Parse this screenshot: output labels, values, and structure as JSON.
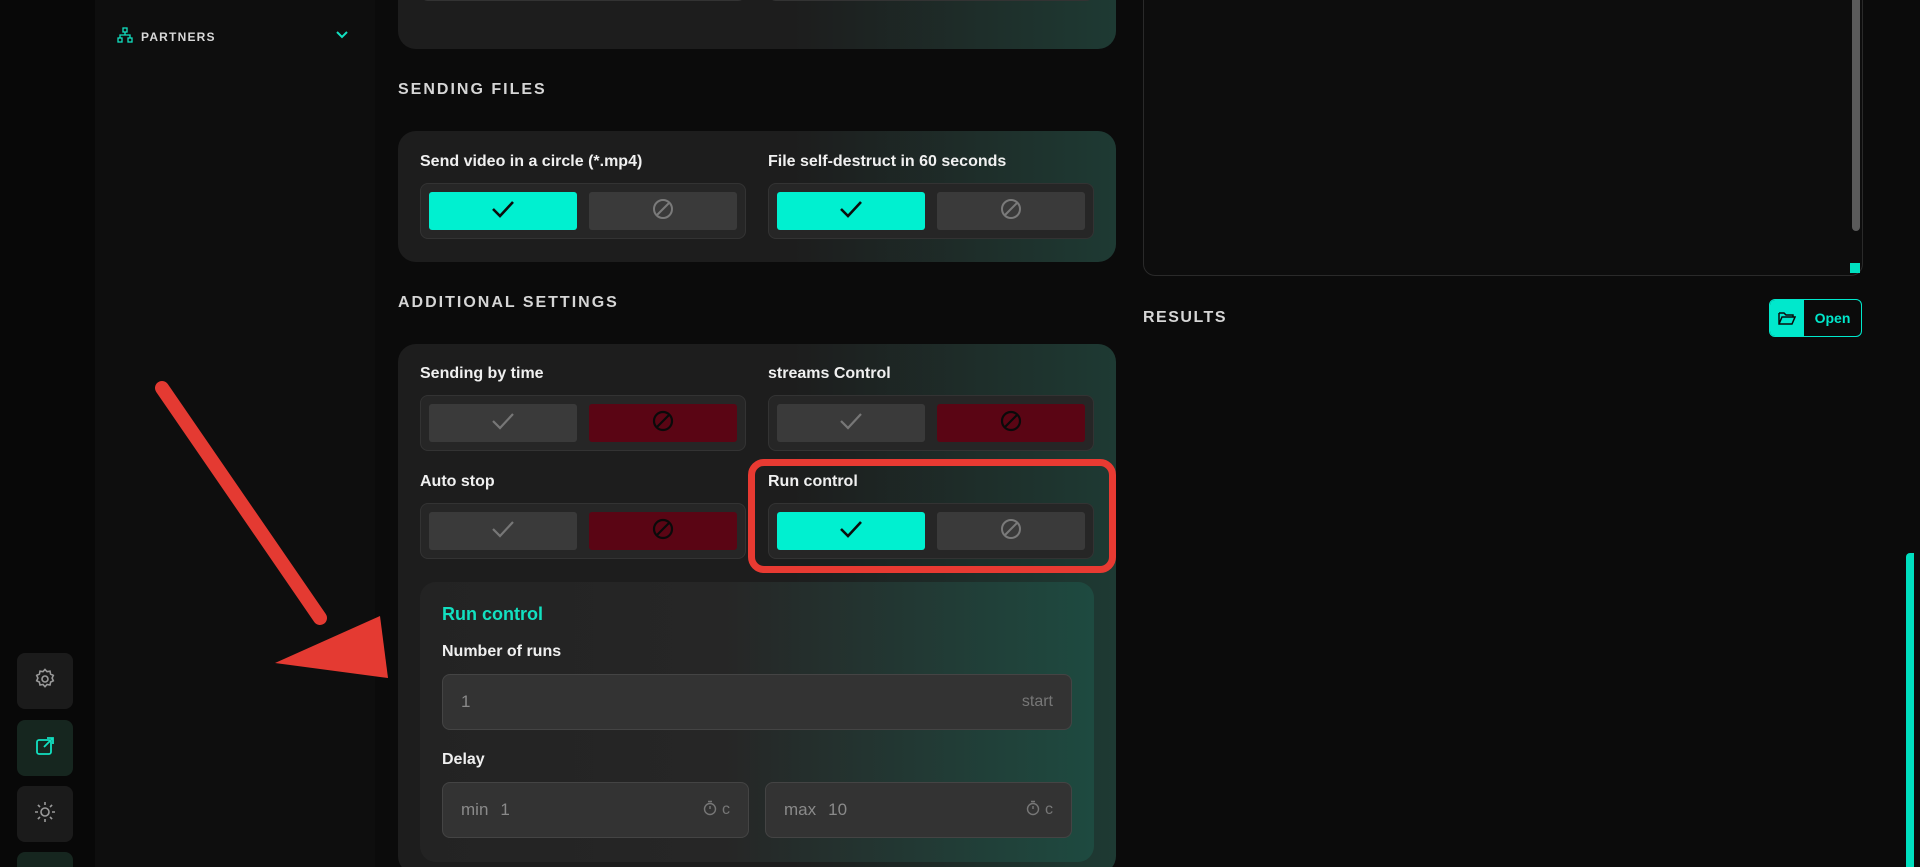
{
  "sidebar": {
    "partners_label": "PARTNERS",
    "partners_icon": "hierarchy-icon"
  },
  "rail": {
    "buttons": [
      {
        "icon": "gear-icon"
      },
      {
        "icon": "external-link-icon",
        "active": true
      },
      {
        "icon": "sun-icon"
      }
    ]
  },
  "sections": {
    "sending_files": "SENDING FILES",
    "additional_settings": "ADDITIONAL SETTINGS",
    "results": "RESULTS"
  },
  "sending_files": {
    "send_video": {
      "label": "Send video in a circle (*.mp4)",
      "value": "on"
    },
    "self_destruct": {
      "label": "File self-destruct in 60 seconds",
      "value": "on"
    }
  },
  "additional": {
    "sending_by_time": {
      "label": "Sending by time",
      "value": "off"
    },
    "streams_control": {
      "label": "streams Control",
      "value": "off"
    },
    "auto_stop": {
      "label": "Auto stop",
      "value": "off"
    },
    "run_control": {
      "label": "Run control",
      "value": "on"
    }
  },
  "run_control_panel": {
    "title": "Run control",
    "number_of_runs_label": "Number of runs",
    "runs_value": "1",
    "runs_suffix": "start",
    "delay_label": "Delay",
    "delay_min_prefix": "min",
    "delay_min_value": "1",
    "delay_max_prefix": "max",
    "delay_max_value": "10",
    "delay_unit": "c"
  },
  "results": {
    "open_label": "Open",
    "open_icon": "folder-open-icon"
  },
  "colors": {
    "accent": "#00f0d0",
    "deny": "#5a0514",
    "highlight": "#e83a32"
  }
}
